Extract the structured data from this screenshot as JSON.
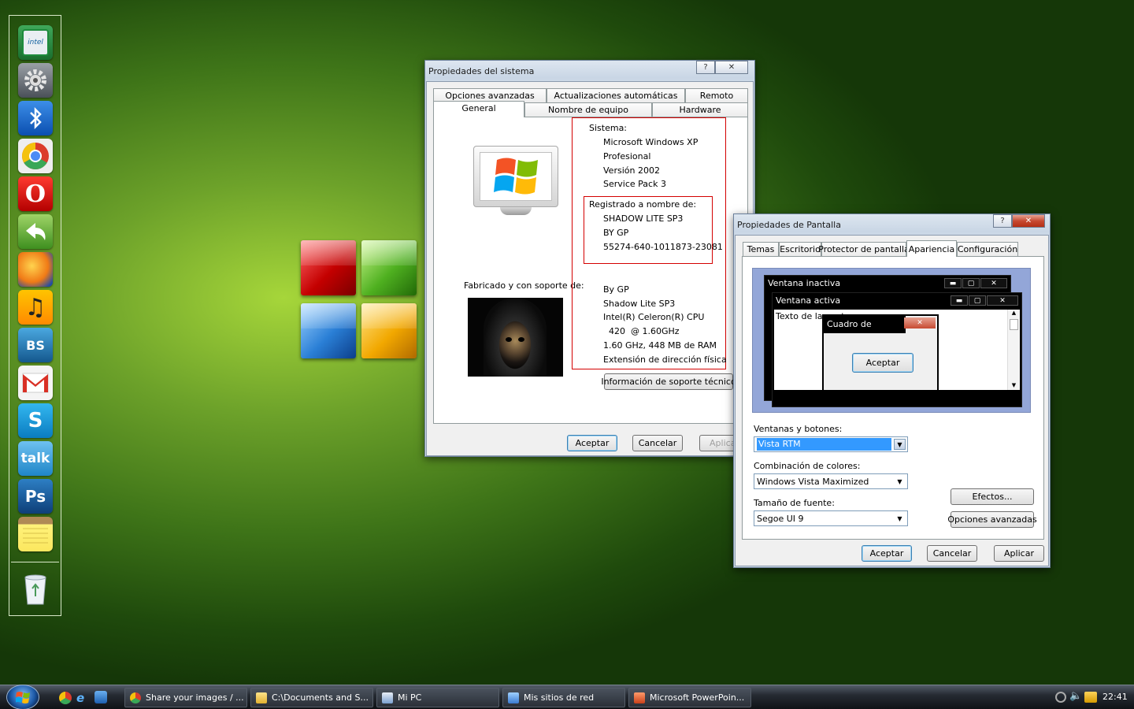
{
  "dock": {
    "items": [
      {
        "name": "intel",
        "label": "intel"
      },
      {
        "name": "settings",
        "label": ""
      },
      {
        "name": "bluetooth",
        "label": ""
      },
      {
        "name": "chrome",
        "label": ""
      },
      {
        "name": "opera",
        "label": "O"
      },
      {
        "name": "reply",
        "label": ""
      },
      {
        "name": "firefox",
        "label": ""
      },
      {
        "name": "music",
        "label": "♫"
      },
      {
        "name": "bs-player",
        "label": "BS"
      },
      {
        "name": "gmail",
        "label": ""
      },
      {
        "name": "skype",
        "label": "S"
      },
      {
        "name": "talk",
        "label": "talk"
      },
      {
        "name": "photoshop",
        "label": "Ps"
      },
      {
        "name": "notes",
        "label": ""
      }
    ],
    "recycle": "recycle-bin"
  },
  "system_properties": {
    "title": "Propiedades del sistema",
    "help": "?",
    "close": "✕",
    "tabs_back": [
      "Opciones avanzadas",
      "Actualizaciones automáticas",
      "Remoto"
    ],
    "tabs_front": [
      "General",
      "Nombre de equipo",
      "Hardware"
    ],
    "system_header": "Sistema:",
    "system_lines": [
      "Microsoft Windows XP",
      "Profesional",
      "Versión 2002",
      "Service Pack 3"
    ],
    "registered_header": "Registrado a nombre de:",
    "registered_lines": [
      "SHADOW LITE SP3",
      "BY GP",
      "55274-640-1011873-23081"
    ],
    "made_by_label": "Fabricado y con soporte de:",
    "made_by_lines": [
      "By GP",
      "Shadow Lite SP3",
      "Intel(R) Celeron(R) CPU",
      "  420  @ 1.60GHz",
      "1.60 GHz, 448 MB de RAM",
      "Extensión de dirección física"
    ],
    "support_button": "Información de soporte técnico",
    "ok": "Aceptar",
    "cancel": "Cancelar",
    "apply": "Aplicar"
  },
  "display_properties": {
    "title": "Propiedades de Pantalla",
    "help": "?",
    "close": "✕",
    "tabs": [
      "Temas",
      "Escritorio",
      "Protector de pantalla",
      "Apariencia",
      "Configuración"
    ],
    "active_tab": "Apariencia",
    "preview": {
      "inactive_title": "Ventana inactiva",
      "active_title": "Ventana activa",
      "window_text": "Texto de la ventana",
      "msgbox_title": "Cuadro de mens...",
      "msgbox_button": "Aceptar"
    },
    "windows_buttons_label": "Ventanas y botones:",
    "windows_buttons_value": "Vista RTM",
    "color_scheme_label": "Combinación de colores:",
    "color_scheme_value": "Windows Vista Maximized",
    "font_size_label": "Tamaño de fuente:",
    "font_size_value": "Segoe UI 9",
    "effects_button": "Efectos...",
    "advanced_button": "Opciones avanzadas",
    "ok": "Aceptar",
    "cancel": "Cancelar",
    "apply": "Aplicar"
  },
  "taskbar": {
    "tasks": [
      {
        "label": "Share your images / ...",
        "icon": "chrome-icon"
      },
      {
        "label": "C:\\Documents and S...",
        "icon": "folder-icon"
      },
      {
        "label": "Mi PC",
        "icon": "computer-icon"
      },
      {
        "label": "Mis sitios de red",
        "icon": "network-icon"
      },
      {
        "label": "Microsoft PowerPoin...",
        "icon": "powerpoint-icon"
      }
    ],
    "clock": "22:41"
  },
  "colors": {
    "accent_selection": "#3399ff",
    "red_highlight": "#d40000",
    "desktop_green": "#5f9a22"
  }
}
